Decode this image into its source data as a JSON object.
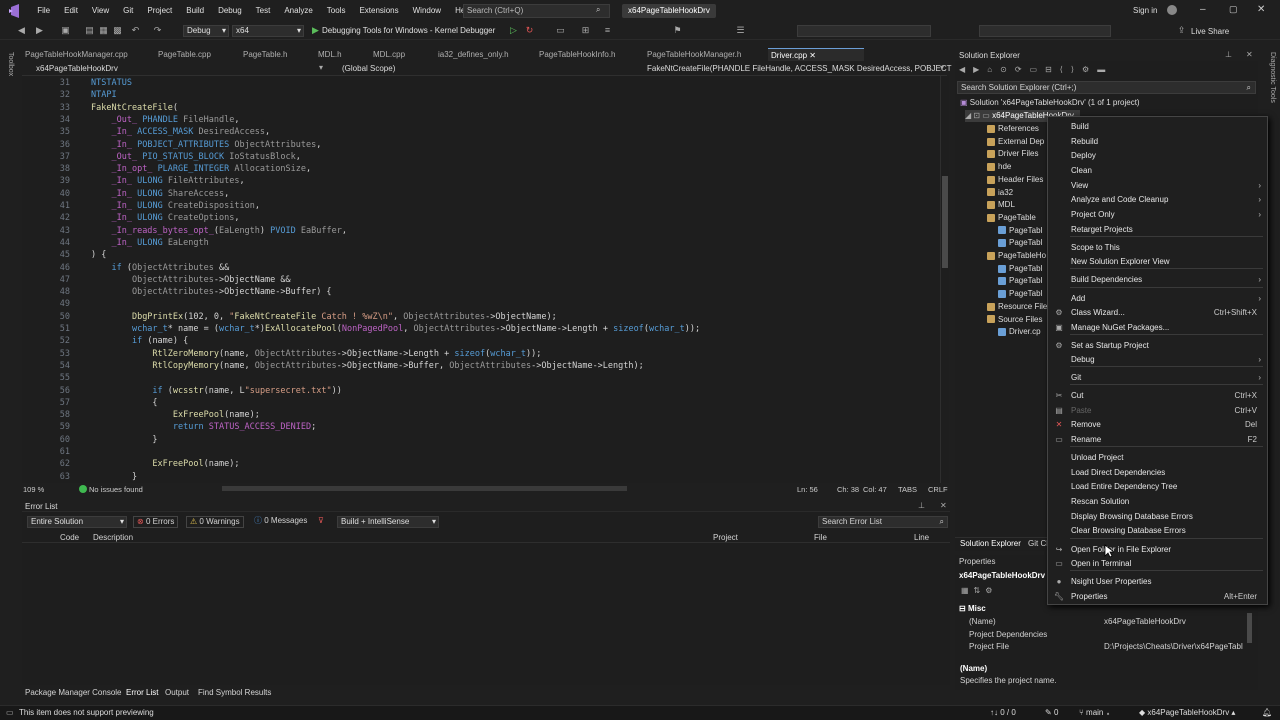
{
  "menu": {
    "items": [
      "File",
      "Edit",
      "View",
      "Git",
      "Project",
      "Build",
      "Debug",
      "Test",
      "Analyze",
      "Tools",
      "Extensions",
      "Window",
      "Help"
    ]
  },
  "search": {
    "placeholder": "Search (Ctrl+Q)"
  },
  "window_title": "x64PageTableHookDrv",
  "account": {
    "signin": "Sign in",
    "liveshare": "Live Share"
  },
  "toolbar": {
    "config": "Debug",
    "platform": "x64",
    "debugger": "Debugging Tools for Windows - Kernel Debugger"
  },
  "tabs": [
    "PageTableHookManager.cpp",
    "PageTable.cpp",
    "PageTable.h",
    "MDL.h",
    "MDL.cpp",
    "ia32_defines_only.h",
    "PageTableHookInfo.h",
    "PageTableHookManager.h",
    "Driver.cpp"
  ],
  "navbar": {
    "project": "x64PageTableHookDrv",
    "scope": "(Global Scope)",
    "func": "FakeNtCreateFile(PHANDLE FileHandle, ACCESS_MASK DesiredAccess, POBJECT"
  },
  "code_lines": [
    {
      "n": "31",
      "t": "NTSTATUS"
    },
    {
      "n": "32",
      "t": "NTAPI"
    },
    {
      "n": "33",
      "t": "FakeNtCreateFile("
    },
    {
      "n": "34",
      "t": "    _Out_ PHANDLE FileHandle,"
    },
    {
      "n": "35",
      "t": "    _In_ ACCESS_MASK DesiredAccess,"
    },
    {
      "n": "36",
      "t": "    _In_ POBJECT_ATTRIBUTES ObjectAttributes,"
    },
    {
      "n": "37",
      "t": "    _Out_ PIO_STATUS_BLOCK IoStatusBlock,"
    },
    {
      "n": "38",
      "t": "    _In_opt_ PLARGE_INTEGER AllocationSize,"
    },
    {
      "n": "39",
      "t": "    _In_ ULONG FileAttributes,"
    },
    {
      "n": "40",
      "t": "    _In_ ULONG ShareAccess,"
    },
    {
      "n": "41",
      "t": "    _In_ ULONG CreateDisposition,"
    },
    {
      "n": "42",
      "t": "    _In_ ULONG CreateOptions,"
    },
    {
      "n": "43",
      "t": "    _In_reads_bytes_opt_(EaLength) PVOID EaBuffer,"
    },
    {
      "n": "44",
      "t": "    _In_ ULONG EaLength"
    },
    {
      "n": "45",
      "t": ") {"
    },
    {
      "n": "46",
      "t": "    if (ObjectAttributes &&"
    },
    {
      "n": "47",
      "t": "        ObjectAttributes->ObjectName &&"
    },
    {
      "n": "48",
      "t": "        ObjectAttributes->ObjectName->Buffer) {"
    },
    {
      "n": "49",
      "t": ""
    },
    {
      "n": "50",
      "t": "        DbgPrintEx(102, 0, \"FakeNtCreateFile Catch ! %wZ\\n\", ObjectAttributes->ObjectName);"
    },
    {
      "n": "51",
      "t": "        wchar_t* name = (wchar_t*)ExAllocatePool(NonPagedPool, ObjectAttributes->ObjectName->Length + sizeof(wchar_t));"
    },
    {
      "n": "52",
      "t": "        if (name) {"
    },
    {
      "n": "53",
      "t": "            RtlZeroMemory(name, ObjectAttributes->ObjectName->Length + sizeof(wchar_t));"
    },
    {
      "n": "54",
      "t": "            RtlCopyMemory(name, ObjectAttributes->ObjectName->Buffer, ObjectAttributes->ObjectName->Length);"
    },
    {
      "n": "55",
      "t": ""
    },
    {
      "n": "56",
      "t": "            if (wcsstr(name, L\"supersecret.txt\"))"
    },
    {
      "n": "57",
      "t": "            {"
    },
    {
      "n": "58",
      "t": "                ExFreePool(name);"
    },
    {
      "n": "59",
      "t": "                return STATUS_ACCESS_DENIED;"
    },
    {
      "n": "60",
      "t": "            }"
    },
    {
      "n": "61",
      "t": ""
    },
    {
      "n": "62",
      "t": "            ExFreePool(name);"
    },
    {
      "n": "63",
      "t": "        }"
    }
  ],
  "editor_status": {
    "zoom": "109 %",
    "issues": "No issues found",
    "pos": "Ln: 56",
    "ch": "Ch: 38",
    "col": "Col: 47",
    "tabs": "TABS",
    "eol": "CRLF"
  },
  "errorlist": {
    "title": "Error List",
    "scope": "Entire Solution",
    "errors": "0 Errors",
    "warnings": "0 Warnings",
    "messages": "0 Messages",
    "build": "Build + IntelliSense",
    "search": "Search Error List",
    "cols": [
      "Code",
      "Description",
      "Project",
      "File",
      "Line"
    ]
  },
  "bottom_tabs": [
    "Package Manager Console",
    "Error List",
    "Output",
    "Find Symbol Results"
  ],
  "solution_explorer": {
    "title": "Solution Explorer",
    "search": "Search Solution Explorer (Ctrl+;)",
    "solution": "Solution 'x64PageTableHookDrv' (1 of 1 project)",
    "project": "x64PageTableHookDrv",
    "items": [
      "References",
      "External Dep",
      "Driver Files",
      "hde",
      "Header Files",
      "ia32",
      "MDL",
      "PageTable",
      "PageTabl",
      "PageTabl",
      "PageTableHo",
      "PageTabl",
      "PageTabl",
      "PageTabl",
      "Resource File",
      "Source Files",
      "Driver.cp"
    ],
    "bottom_tabs": [
      "Solution Explorer",
      "Git Ch"
    ]
  },
  "context_menu": {
    "items": [
      {
        "label": "Build"
      },
      {
        "label": "Rebuild"
      },
      {
        "label": "Deploy"
      },
      {
        "label": "Clean"
      },
      {
        "label": "View",
        "sub": true
      },
      {
        "label": "Analyze and Code Cleanup",
        "sub": true
      },
      {
        "label": "Project Only",
        "sub": true
      },
      {
        "label": "Retarget Projects"
      },
      {
        "label": "Scope to This"
      },
      {
        "label": "New Solution Explorer View"
      },
      {
        "label": "Build Dependencies",
        "sub": true
      },
      {
        "label": "Add",
        "sub": true
      },
      {
        "label": "Class Wizard...",
        "shortcut": "Ctrl+Shift+X"
      },
      {
        "label": "Manage NuGet Packages..."
      },
      {
        "label": "Set as Startup Project"
      },
      {
        "label": "Debug",
        "sub": true
      },
      {
        "label": "Git",
        "sub": true
      },
      {
        "label": "Cut",
        "shortcut": "Ctrl+X"
      },
      {
        "label": "Paste",
        "shortcut": "Ctrl+V",
        "disabled": true
      },
      {
        "label": "Remove",
        "shortcut": "Del"
      },
      {
        "label": "Rename",
        "shortcut": "F2"
      },
      {
        "label": "Unload Project"
      },
      {
        "label": "Load Direct Dependencies"
      },
      {
        "label": "Load Entire Dependency Tree"
      },
      {
        "label": "Rescan Solution"
      },
      {
        "label": "Display Browsing Database Errors"
      },
      {
        "label": "Clear Browsing Database Errors"
      },
      {
        "label": "Open Folder in File Explorer"
      },
      {
        "label": "Open in Terminal"
      },
      {
        "label": "Nsight User Properties"
      },
      {
        "label": "Properties",
        "shortcut": "Alt+Enter"
      }
    ]
  },
  "properties": {
    "title": "Properties",
    "object": "x64PageTableHookDrv",
    "category": "Misc",
    "rows": [
      {
        "k": "(Name)",
        "v": "x64PageTableHookDrv"
      },
      {
        "k": "Project Dependencies",
        "v": ""
      },
      {
        "k": "Project File",
        "v": "D:\\Projects\\Cheats\\Driver\\x64PageTabl"
      }
    ],
    "desc_title": "(Name)",
    "desc": "Specifies the project name."
  },
  "statusbar": {
    "left": "This item does not support previewing",
    "counts": "0 / 0",
    "pencil": "0",
    "branch": "main",
    "repo": "x64PageTableHookDrv"
  }
}
